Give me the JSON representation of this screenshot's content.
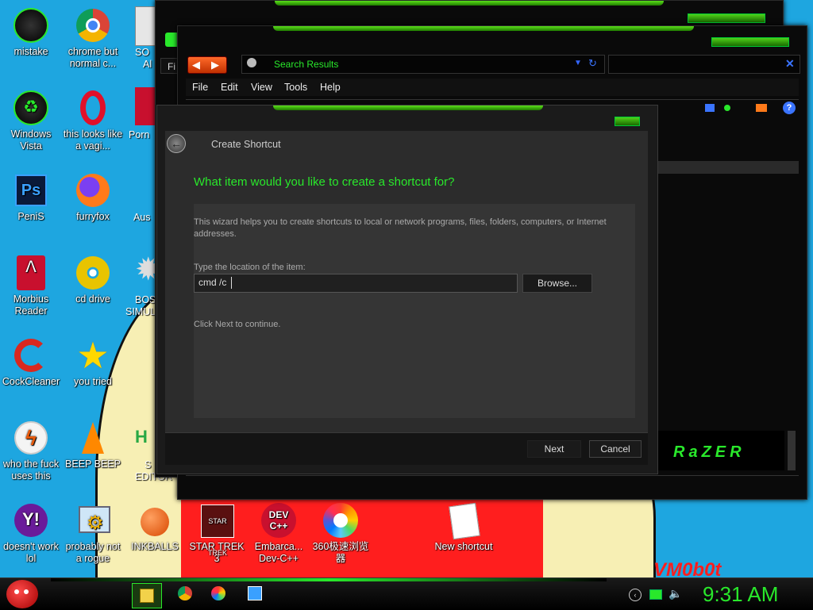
{
  "colors": {
    "accent_green": "#29e82b",
    "desktop_blue": "#1ea6e0",
    "red": "#ff1e1e"
  },
  "desktop": {
    "icons": [
      {
        "label": "mistake",
        "icon": "razer-icon"
      },
      {
        "label": "chrome but normal c...",
        "icon": "chrome-icon"
      },
      {
        "label": "Windows Vista",
        "icon": "recycle-icon"
      },
      {
        "label": "this looks like a vagi...",
        "icon": "opera-icon"
      },
      {
        "label": "PeniS",
        "icon": "photoshop-icon"
      },
      {
        "label": "furryfox",
        "icon": "firefox-icon"
      },
      {
        "label": "Morbius Reader",
        "icon": "pdf-icon"
      },
      {
        "label": "cd drive",
        "icon": "cd-icon"
      },
      {
        "label": "CockCleaner",
        "icon": "ccleaner-icon"
      },
      {
        "label": "you tried",
        "icon": "star-icon"
      },
      {
        "label": "who the fuck uses this",
        "icon": "flash-icon"
      },
      {
        "label": "BEEP BEEP",
        "icon": "vlc-icon"
      },
      {
        "label": "doesn't work lol",
        "icon": "yahoo-icon"
      },
      {
        "label": "probably not a rogue",
        "icon": "gears-icon"
      },
      {
        "label": "INKBALLS",
        "icon": "inkball-icon"
      },
      {
        "label": "STAR TREK 3",
        "icon": "startrek-icon"
      },
      {
        "label": "Embarca... Dev-C++",
        "icon": "devcpp-icon"
      },
      {
        "label": "360极速浏览器",
        "icon": "browser360-icon"
      },
      {
        "label": "New shortcut",
        "icon": "shortcut-icon"
      }
    ],
    "partial": [
      "SO",
      "Al",
      "Porn",
      "Aus",
      "BOS",
      "SIMUL",
      "S",
      "EDITOR"
    ],
    "devcpp_badge": "DEV C++",
    "startrek_badge": "STAR TREK",
    "watermark": "VM0b0t"
  },
  "explorer": {
    "address": "Search Results",
    "menu": [
      "File",
      "Edit",
      "View",
      "Tools",
      "Help"
    ],
    "back_partial": "Fi",
    "brand": "RaZER"
  },
  "dialog": {
    "title": "Create Shortcut",
    "heading": "What item would you like to create a shortcut for?",
    "description": "This wizard helps you to create shortcuts to local or network programs, files, folders, computers, or Internet addresses.",
    "location_label": "Type the location of the item:",
    "location_value": "cmd /c",
    "browse": "Browse...",
    "hint": "Click Next to continue.",
    "next": "Next",
    "cancel": "Cancel"
  },
  "taskbar": {
    "clock": "9:31 AM"
  }
}
